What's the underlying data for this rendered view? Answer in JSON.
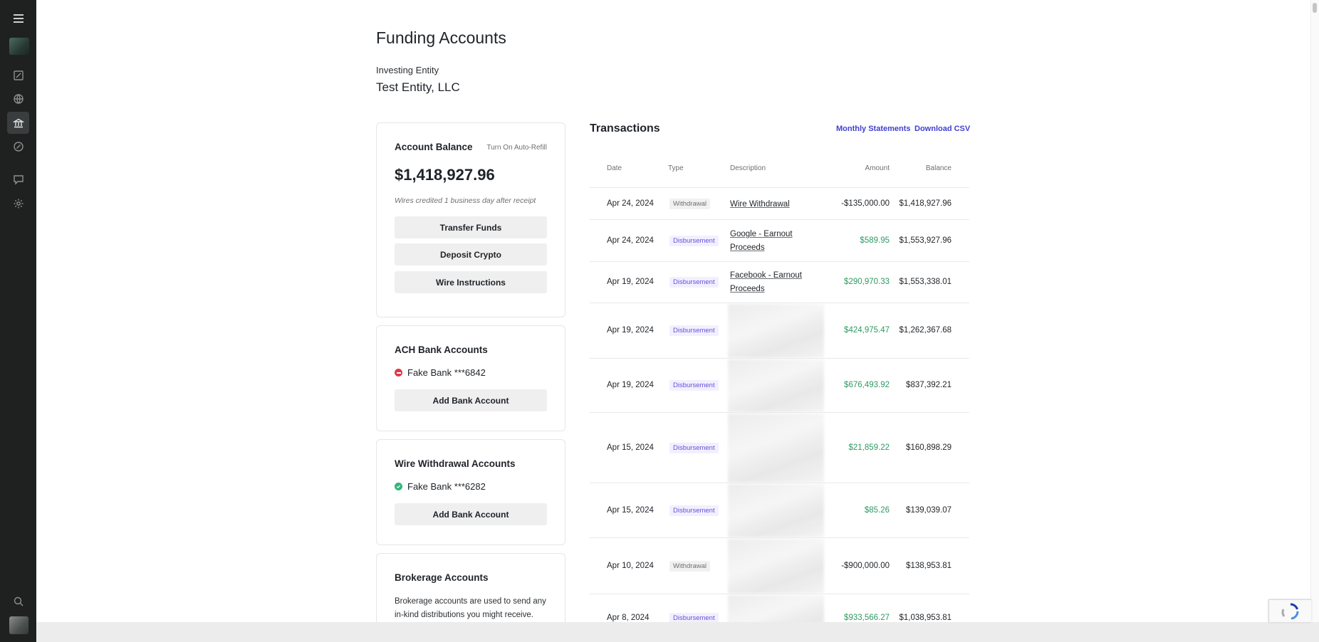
{
  "sidebar": {
    "items": [
      {
        "name": "menu",
        "icon": "menu-icon"
      },
      {
        "name": "logo",
        "icon": "logo"
      },
      {
        "name": "edit",
        "icon": "edit-icon"
      },
      {
        "name": "globe",
        "icon": "globe-icon"
      },
      {
        "name": "bank",
        "icon": "bank-icon",
        "active": true
      },
      {
        "name": "gauge",
        "icon": "gauge-icon"
      },
      {
        "name": "messages",
        "icon": "message-icon"
      },
      {
        "name": "settings",
        "icon": "gear-icon"
      },
      {
        "name": "search",
        "icon": "search-icon"
      },
      {
        "name": "avatar",
        "icon": "avatar"
      }
    ]
  },
  "page": {
    "title": "Funding Accounts",
    "entity_label": "Investing Entity",
    "entity_name": "Test Entity, LLC"
  },
  "account_balance": {
    "title": "Account Balance",
    "auto_refill_link": "Turn On Auto-Refill",
    "amount": "$1,418,927.96",
    "note": "Wires credited 1 business day after receipt",
    "buttons": {
      "transfer": "Transfer Funds",
      "deposit_crypto": "Deposit Crypto",
      "wire_instructions": "Wire Instructions"
    }
  },
  "ach": {
    "title": "ACH Bank Accounts",
    "account": "Fake Bank ***6842",
    "status": "error",
    "add_button": "Add Bank Account"
  },
  "wire_withdrawal": {
    "title": "Wire Withdrawal Accounts",
    "account": "Fake Bank ***6282",
    "status": "verified",
    "add_button": "Add Bank Account"
  },
  "brokerage": {
    "title": "Brokerage Accounts",
    "text": "Brokerage accounts are used to send any in-kind distributions you might receive."
  },
  "transactions": {
    "title": "Transactions",
    "links": {
      "monthly_statements": "Monthly Statements",
      "download_csv": "Download CSV"
    },
    "columns": {
      "date": "Date",
      "type": "Type",
      "description": "Description",
      "amount": "Amount",
      "balance": "Balance"
    },
    "rows": [
      {
        "date": "Apr 24, 2024",
        "type": "Withdrawal",
        "description": "Wire Withdrawal",
        "amount": "-$135,000.00",
        "balance": "$1,418,927.96",
        "sign": "neg"
      },
      {
        "date": "Apr 24, 2024",
        "type": "Disbursement",
        "description": "Google - Earnout Proceeds",
        "amount": "$589.95",
        "balance": "$1,553,927.96",
        "sign": "pos"
      },
      {
        "date": "Apr 19, 2024",
        "type": "Disbursement",
        "description": "Facebook - Earnout Proceeds",
        "amount": "$290,970.33",
        "balance": "$1,553,338.01",
        "sign": "pos"
      },
      {
        "date": "Apr 19, 2024",
        "type": "Disbursement",
        "description": "",
        "amount": "$424,975.47",
        "balance": "$1,262,367.68",
        "sign": "pos",
        "redacted": true
      },
      {
        "date": "Apr 19, 2024",
        "type": "Disbursement",
        "description": "",
        "amount": "$676,493.92",
        "balance": "$837,392.21",
        "sign": "pos",
        "redacted": true
      },
      {
        "date": "Apr 15, 2024",
        "type": "Disbursement",
        "description": "",
        "amount": "$21,859.22",
        "balance": "$160,898.29",
        "sign": "pos",
        "redacted": true
      },
      {
        "date": "Apr 15, 2024",
        "type": "Disbursement",
        "description": "",
        "amount": "$85.26",
        "balance": "$139,039.07",
        "sign": "pos",
        "redacted": true
      },
      {
        "date": "Apr 10, 2024",
        "type": "Withdrawal",
        "description": "",
        "amount": "-$900,000.00",
        "balance": "$138,953.81",
        "sign": "neg",
        "redacted": true
      },
      {
        "date": "Apr 8, 2024",
        "type": "Disbursement",
        "description": "",
        "amount": "$933,566.27",
        "balance": "$1,038,953.81",
        "sign": "pos",
        "redacted": true
      }
    ]
  },
  "colors": {
    "accent_link": "#3f3fd1",
    "positive": "#2e9a63",
    "disbursement_badge": "#6a4fd6",
    "error_dot": "#e0394a",
    "success_dot": "#2fb67c",
    "sidebar_bg": "#1f2121"
  }
}
